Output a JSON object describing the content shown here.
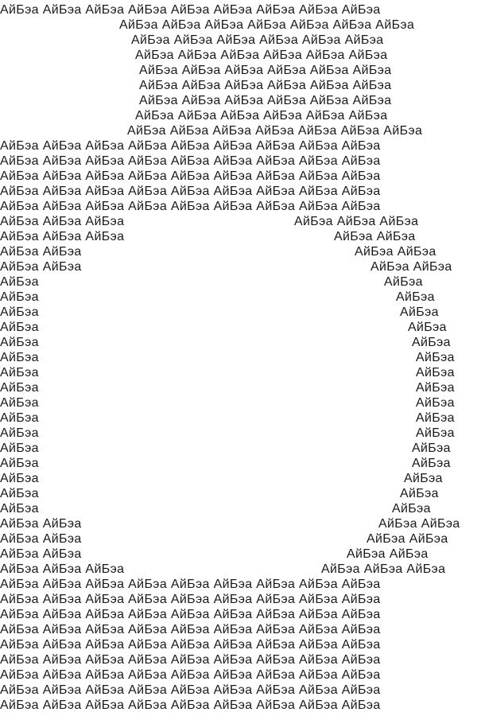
{
  "word": "АйБэа",
  "text_color": "#1a1a1a",
  "background": "#ffffff",
  "rows": [
    {
      "segments": [
        {
          "count": 9
        }
      ]
    },
    {
      "segments": [
        {
          "count": 7
        }
      ]
    },
    {
      "segments": [
        {
          "count": 6
        }
      ]
    },
    {
      "segments": [
        {
          "count": 6
        }
      ]
    },
    {
      "segments": [
        {
          "count": 6
        }
      ]
    },
    {
      "segments": [
        {
          "count": 6
        }
      ]
    },
    {
      "segments": [
        {
          "count": 6
        }
      ]
    },
    {
      "segments": [
        {
          "count": 6
        }
      ]
    },
    {
      "segments": [
        {
          "count": 7
        }
      ]
    },
    {
      "segments": [
        {
          "count": 9
        }
      ]
    },
    {
      "segments": [
        {
          "count": 9
        }
      ]
    },
    {
      "segments": [
        {
          "count": 9
        }
      ]
    },
    {
      "segments": [
        {
          "count": 9
        }
      ]
    },
    {
      "segments": [
        {
          "count": 9
        }
      ]
    },
    {
      "segments": [
        {
          "count": 3
        },
        {
          "count": 3
        }
      ]
    },
    {
      "segments": [
        {
          "count": 3
        },
        {
          "count": 2
        }
      ]
    },
    {
      "segments": [
        {
          "count": 2
        },
        {
          "count": 2
        }
      ]
    },
    {
      "segments": [
        {
          "count": 2
        },
        {
          "count": 2
        }
      ]
    },
    {
      "segments": [
        {
          "count": 1
        },
        {
          "count": 1
        }
      ]
    },
    {
      "segments": [
        {
          "count": 1
        },
        {
          "count": 1
        }
      ]
    },
    {
      "segments": [
        {
          "count": 1
        },
        {
          "count": 1
        }
      ]
    },
    {
      "segments": [
        {
          "count": 1
        },
        {
          "count": 1
        }
      ]
    },
    {
      "segments": [
        {
          "count": 1
        },
        {
          "count": 1
        }
      ]
    },
    {
      "segments": [
        {
          "count": 1
        },
        {
          "count": 1
        }
      ]
    },
    {
      "segments": [
        {
          "count": 1
        },
        {
          "count": 1
        }
      ]
    },
    {
      "segments": [
        {
          "count": 1
        },
        {
          "count": 1
        }
      ]
    },
    {
      "segments": [
        {
          "count": 1
        },
        {
          "count": 1
        }
      ]
    },
    {
      "segments": [
        {
          "count": 1
        },
        {
          "count": 1
        }
      ]
    },
    {
      "segments": [
        {
          "count": 1
        },
        {
          "count": 1
        }
      ]
    },
    {
      "segments": [
        {
          "count": 1
        },
        {
          "count": 1
        }
      ]
    },
    {
      "segments": [
        {
          "count": 1
        },
        {
          "count": 1
        }
      ]
    },
    {
      "segments": [
        {
          "count": 1
        },
        {
          "count": 1
        }
      ]
    },
    {
      "segments": [
        {
          "count": 1
        },
        {
          "count": 1
        }
      ]
    },
    {
      "segments": [
        {
          "count": 1
        },
        {
          "count": 1
        }
      ]
    },
    {
      "segments": [
        {
          "count": 2
        },
        {
          "count": 2
        }
      ]
    },
    {
      "segments": [
        {
          "count": 2
        },
        {
          "count": 2
        }
      ]
    },
    {
      "segments": [
        {
          "count": 2
        },
        {
          "count": 2
        }
      ]
    },
    {
      "segments": [
        {
          "count": 3
        },
        {
          "count": 3
        }
      ]
    },
    {
      "segments": [
        {
          "count": 9
        }
      ]
    },
    {
      "segments": [
        {
          "count": 9
        }
      ]
    },
    {
      "segments": [
        {
          "count": 9
        }
      ]
    },
    {
      "segments": [
        {
          "count": 9
        }
      ]
    },
    {
      "segments": [
        {
          "count": 9
        }
      ]
    },
    {
      "segments": [
        {
          "count": 9
        }
      ]
    },
    {
      "segments": [
        {
          "count": 9
        }
      ]
    },
    {
      "segments": [
        {
          "count": 9
        }
      ]
    },
    {
      "segments": [
        {
          "count": 9
        }
      ]
    }
  ]
}
